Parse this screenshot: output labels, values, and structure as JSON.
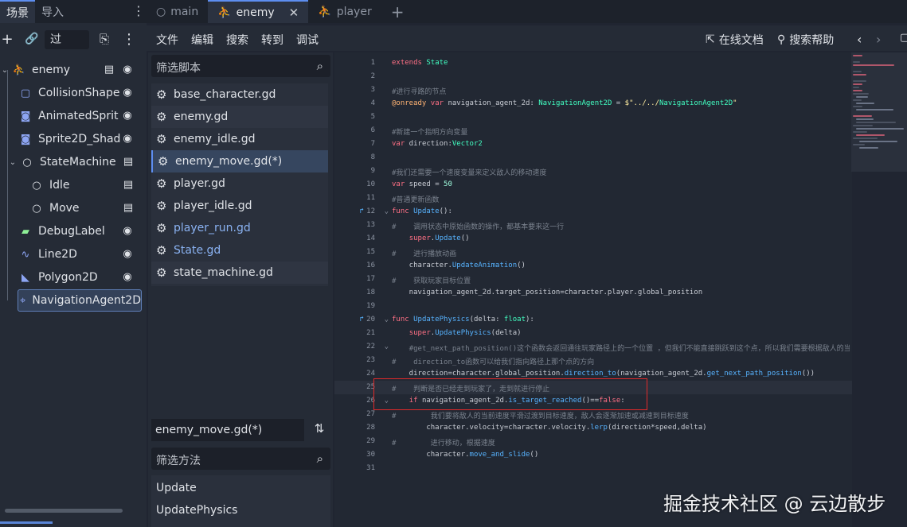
{
  "scene_dock": {
    "tabs": [
      "场景",
      "导入"
    ],
    "filter_text": "过",
    "tree": [
      {
        "label": "enemy",
        "icon": "character-body-icon"
      },
      {
        "label": "CollisionShape",
        "icon": "collision-shape-icon"
      },
      {
        "label": "AnimatedSprit",
        "icon": "animated-sprite-icon"
      },
      {
        "label": "Sprite2D_Shad",
        "icon": "sprite2d-icon"
      },
      {
        "label": "StateMachine",
        "icon": "node-icon"
      },
      {
        "label": "Idle",
        "icon": "node-icon"
      },
      {
        "label": "Move",
        "icon": "node-icon"
      },
      {
        "label": "DebugLabel",
        "icon": "label-icon"
      },
      {
        "label": "Line2D",
        "icon": "line2d-icon"
      },
      {
        "label": "Polygon2D",
        "icon": "polygon2d-icon"
      },
      {
        "label": "NavigationAgent2D",
        "icon": "navigation-agent-icon"
      }
    ]
  },
  "editor_tabs": [
    {
      "label": "main",
      "icon": "node-icon"
    },
    {
      "label": "enemy",
      "icon": "character-body-icon"
    },
    {
      "label": "player",
      "icon": "character-body-icon"
    }
  ],
  "menubar": {
    "items": [
      "文件",
      "编辑",
      "搜索",
      "转到",
      "调试"
    ],
    "online_docs": "在线文档",
    "search_help": "搜索帮助"
  },
  "script_panel": {
    "filter_placeholder": "筛选脚本",
    "scripts": [
      {
        "name": "base_character.gd",
        "modified": false
      },
      {
        "name": "enemy.gd",
        "modified": false
      },
      {
        "name": "enemy_idle.gd",
        "modified": false
      },
      {
        "name": "enemy_move.gd(*)",
        "modified": false,
        "selected": true
      },
      {
        "name": "player.gd",
        "modified": false
      },
      {
        "name": "player_idle.gd",
        "modified": false
      },
      {
        "name": "player_run.gd",
        "modified": true
      },
      {
        "name": "State.gd",
        "modified": true
      },
      {
        "name": "state_machine.gd",
        "modified": false
      }
    ],
    "current_file": "enemy_move.gd(*)",
    "method_filter_placeholder": "筛选方法",
    "methods": [
      "Update",
      "UpdatePhysics"
    ]
  },
  "code": {
    "line_numbers": [
      "1",
      "2",
      "3",
      "4",
      "5",
      "6",
      "7",
      "8",
      "9",
      "10",
      "11",
      "12",
      "13",
      "14",
      "15",
      "16",
      "17",
      "18",
      "19",
      "20",
      "21",
      "22",
      "23",
      "24",
      "25",
      "26",
      "27",
      "28",
      "29",
      "30",
      "31"
    ],
    "lines": [
      "extends State",
      "",
      "#进行寻路的节点",
      "@onready var navigation_agent_2d: NavigationAgent2D = $\"../../NavigationAgent2D\"",
      "",
      "#新建一个指明方向变量",
      "var direction:Vector2",
      "",
      "#我们还需要一个速度变量来定义敌人的移动速度",
      "var speed = 50",
      "#普通更新函数",
      "func Update():",
      "#    调用状态中原始函数的操作，都基本要来这一行",
      "    super.Update()",
      "#    进行播放动画",
      "    character.UpdateAnimation()",
      "#    获取玩家目标位置",
      "    navigation_agent_2d.target_position=character.player.global_position",
      "",
      "func UpdatePhysics(delta: float):",
      "    super.UpdatePhysics(delta)",
      "    #get_next_path_position()这个函数会返回通往玩家路径上的一个位置 ，但我们不能直接跳跃到这个点，所以我们需要根据敌人的当",
      "#    direction_to函数可以给我们指向路径上那个点的方向",
      "    direction=character.global_position.direction_to(navigation_agent_2d.get_next_path_position())",
      "#    判断是否已经走到玩家了，走到就进行停止",
      "    if navigation_agent_2d.is_target_reached()==false:",
      "#        我们要将敌人的当前速度平滑过渡到目标速度，敌人会逐渐加速或减速到目标速度",
      "        character.velocity=character.velocity.lerp(direction*speed,delta)",
      "#        进行移动，根据速度",
      "        character.move_and_slide()",
      ""
    ]
  },
  "watermark": "掘金技术社区 @ 云边散步",
  "colors": {
    "accent": "#5d8ef0",
    "keyword": "#ff7085",
    "type": "#42ffc2",
    "function": "#57b3ff",
    "highlight_box": "#e02a2a"
  }
}
